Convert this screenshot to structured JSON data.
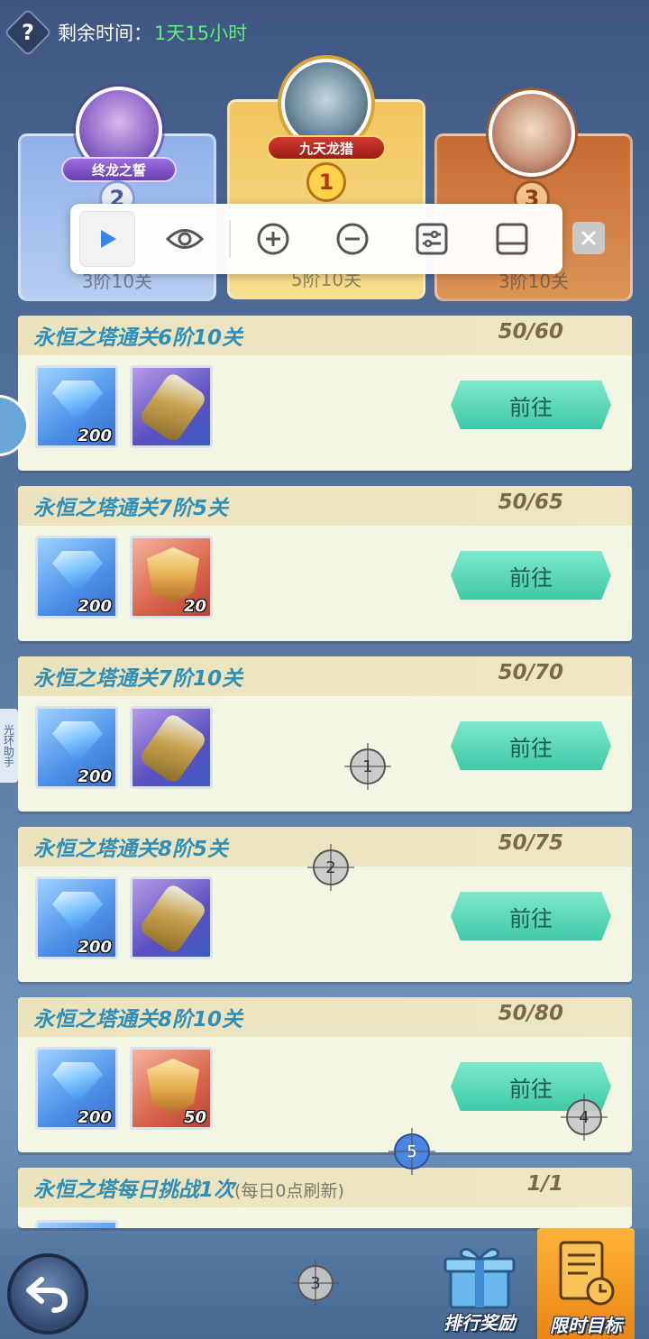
{
  "header": {
    "timer_label": "剩余时间：",
    "timer_value": "1天15小时"
  },
  "podium": {
    "first": {
      "name": "九天龙猎",
      "rank": "1",
      "progress": "5阶10关"
    },
    "second": {
      "name": "终龙之誓",
      "rank": "2",
      "progress": "3阶10关"
    },
    "third": {
      "rank": "3",
      "progress": "3阶10关"
    }
  },
  "tasks": [
    {
      "title": "永恒之塔通关6阶10关",
      "count": "50/60",
      "rewards": [
        {
          "icon": "diamond-icon",
          "qty": "200"
        },
        {
          "icon": "scroll-icon",
          "qty": ""
        }
      ],
      "button": "前往"
    },
    {
      "title": "永恒之塔通关7阶5关",
      "count": "50/65",
      "rewards": [
        {
          "icon": "diamond-icon",
          "qty": "200"
        },
        {
          "icon": "armor-icon",
          "qty": "20"
        }
      ],
      "button": "前往"
    },
    {
      "title": "永恒之塔通关7阶10关",
      "count": "50/70",
      "rewards": [
        {
          "icon": "diamond-icon",
          "qty": "200"
        },
        {
          "icon": "scroll-icon",
          "qty": ""
        }
      ],
      "button": "前往"
    },
    {
      "title": "永恒之塔通关8阶5关",
      "count": "50/75",
      "rewards": [
        {
          "icon": "diamond-icon",
          "qty": "200"
        },
        {
          "icon": "scroll-icon",
          "qty": ""
        }
      ],
      "button": "前往"
    },
    {
      "title": "永恒之塔通关8阶10关",
      "count": "50/80",
      "rewards": [
        {
          "icon": "diamond-icon",
          "qty": "200"
        },
        {
          "icon": "armor-icon",
          "qty": "50"
        }
      ],
      "button": "前往"
    },
    {
      "title": "永恒之塔每日挑战1次",
      "note": "(每日0点刷新)",
      "count": "1/1"
    }
  ],
  "side_tab": {
    "label": "光环助手"
  },
  "bottom": {
    "ranking_label": "排行奖励",
    "limited_label": "限时目标"
  },
  "markers": [
    "1",
    "2",
    "3",
    "4",
    "5"
  ],
  "colors": {
    "accent_go": "#3fc9a8",
    "timer_green": "#5cf07a",
    "title_blue": "#2f8fb8"
  }
}
